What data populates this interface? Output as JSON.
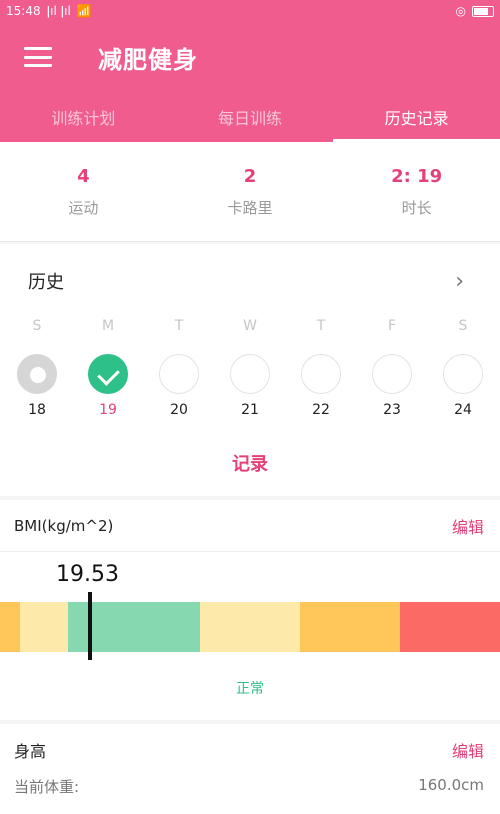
{
  "status_bar": {
    "time": "15:48",
    "signal": "ǀıl ǀıl",
    "wifi_icon": "wifi-icon",
    "right_icon": "alarm-icon"
  },
  "app": {
    "title": "减肥健身"
  },
  "tabs": [
    {
      "label": "训练计划",
      "active": false
    },
    {
      "label": "每日训练",
      "active": false
    },
    {
      "label": "历史记录",
      "active": true
    }
  ],
  "stats": [
    {
      "value": "4",
      "label": "运动"
    },
    {
      "value": "2",
      "label": "卡路里"
    },
    {
      "value": "2: 19",
      "label": "时长"
    }
  ],
  "history": {
    "title": "历史",
    "days": [
      {
        "dow": "S",
        "date": "18",
        "state": "today-gray"
      },
      {
        "dow": "M",
        "date": "19",
        "state": "done",
        "selected": true
      },
      {
        "dow": "T",
        "date": "20",
        "state": "empty"
      },
      {
        "dow": "W",
        "date": "21",
        "state": "empty"
      },
      {
        "dow": "T",
        "date": "22",
        "state": "empty"
      },
      {
        "dow": "F",
        "date": "23",
        "state": "empty"
      },
      {
        "dow": "S",
        "date": "24",
        "state": "empty"
      }
    ],
    "record_label": "记录"
  },
  "bmi": {
    "title": "BMI(kg/m^2)",
    "edit_label": "编辑",
    "value": "19.53",
    "status": "正常",
    "colors": {
      "seg1": "#ffc75a",
      "seg2": "#fde9a9",
      "seg3": "#86d8b0",
      "seg4": "#fde9a9",
      "seg5": "#ffc75a",
      "seg6": "#fb6a64"
    }
  },
  "height": {
    "title": "身高",
    "edit_label": "编辑",
    "weight_label": "当前体重:",
    "height_value": "160.0cm"
  },
  "colors": {
    "primary": "#ef5c8d",
    "accent": "#e6407a",
    "success": "#2ec089"
  }
}
